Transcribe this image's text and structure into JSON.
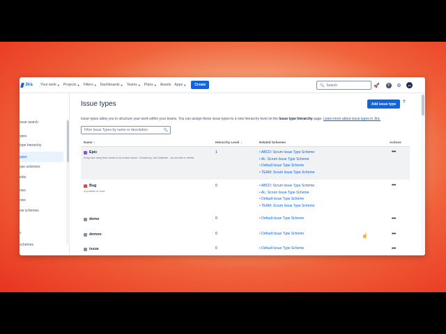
{
  "colors": {
    "brand": "#0c66e4",
    "epic_icon": "#904ee2",
    "bug_icon": "#e34935",
    "neutral_icon": "#8590a2"
  },
  "nav": {
    "logo_text": "Jira",
    "items": [
      {
        "label": "Your work"
      },
      {
        "label": "Projects"
      },
      {
        "label": "Filters"
      },
      {
        "label": "Dashboards"
      },
      {
        "label": "Teams"
      },
      {
        "label": "Plans"
      },
      {
        "label": "Assets"
      },
      {
        "label": "Apps"
      }
    ],
    "create_label": "Create",
    "search_placeholder": "Search"
  },
  "sidebar": {
    "items": [
      {
        "label": "ssue search"
      },
      {
        "label": "ypes"
      },
      {
        "label": "type hierarchy"
      },
      {
        "label": "ypes"
      },
      {
        "label": "ype schemes"
      },
      {
        "label": "elds"
      },
      {
        "label": "ows"
      },
      {
        "label": "ows"
      },
      {
        "label": "ow schemes"
      },
      {
        "label": "s"
      },
      {
        "label": "schemes"
      }
    ]
  },
  "main": {
    "title": "Issue types",
    "add_button": "Add issue type",
    "help_mark": "?",
    "description_pre": "Issue types allow you to structure your work within your teams. You can assign these issue types to a new hierarchy level on the ",
    "description_bold": "Issue type hierarchy",
    "description_mid": " page. ",
    "description_link": "Learn more about issue types in Jira.",
    "filter_placeholder": "Filter Issue Types by name or description",
    "columns": {
      "name": "Name",
      "hierarchy": "Hierarchy Level",
      "schemes": "Related Schemes",
      "actions": "Actions"
    },
    "rows": [
      {
        "name": "Epic",
        "icon": "epic-icon",
        "description": "A big user story that needs to be broken down. Created by Jira Software - do not edit or delete.",
        "hierarchy": "1",
        "schemes": [
          "ABCD: Scrum Issue Type Scheme",
          "AL: Scrum Issue Type Scheme",
          "Default Issue Type Scheme",
          "TEAM: Scrum Issue Type Scheme"
        ]
      },
      {
        "name": "Bug",
        "icon": "bug-icon",
        "description": "A problem or error.",
        "hierarchy": "0",
        "schemes": [
          "ABCD: Scrum Issue Type Scheme",
          "AL: Scrum Issue Type Scheme",
          "Default Issue Type Scheme",
          "TEAM: Scrum Issue Type Scheme"
        ]
      },
      {
        "name": "demo",
        "icon": "task-icon",
        "description": "",
        "hierarchy": "0",
        "schemes": [
          "Default Issue Type Scheme"
        ]
      },
      {
        "name": "demoo",
        "icon": "task-icon",
        "description": "",
        "hierarchy": "0",
        "schemes": [
          "Default Issue Type Scheme"
        ]
      },
      {
        "name": "issue",
        "icon": "task-icon",
        "description": "",
        "hierarchy": "0",
        "schemes": [
          "Default Issue Type Scheme"
        ]
      }
    ],
    "actions_glyph": "•••"
  }
}
